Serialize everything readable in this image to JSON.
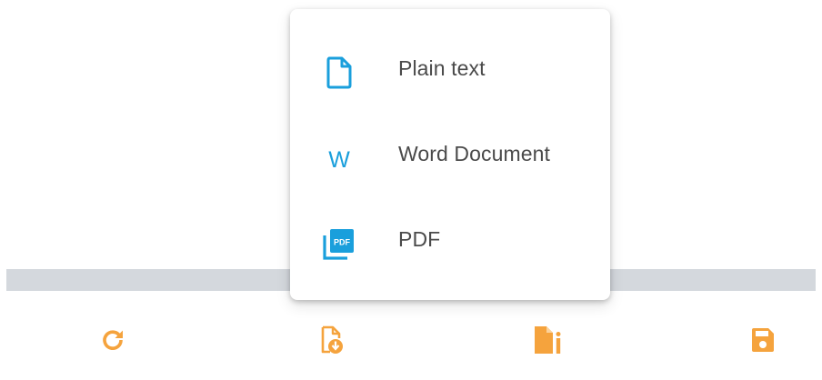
{
  "menu": {
    "items": [
      {
        "label": "Plain text",
        "icon": "document-icon"
      },
      {
        "label": "Word Document",
        "icon": "word-icon",
        "glyph": "W"
      },
      {
        "label": "PDF",
        "icon": "pdf-icon",
        "badge": "PDF"
      }
    ]
  },
  "toolbar": {
    "buttons": [
      {
        "icon": "refresh-icon"
      },
      {
        "icon": "document-download-icon"
      },
      {
        "icon": "document-info-icon"
      },
      {
        "icon": "save-icon"
      }
    ]
  },
  "colors": {
    "accent_blue": "#1a9fdc",
    "toolbar_orange": "#f5a33d",
    "divider": "#d4d8dd",
    "label_text": "#4a4a4a"
  }
}
